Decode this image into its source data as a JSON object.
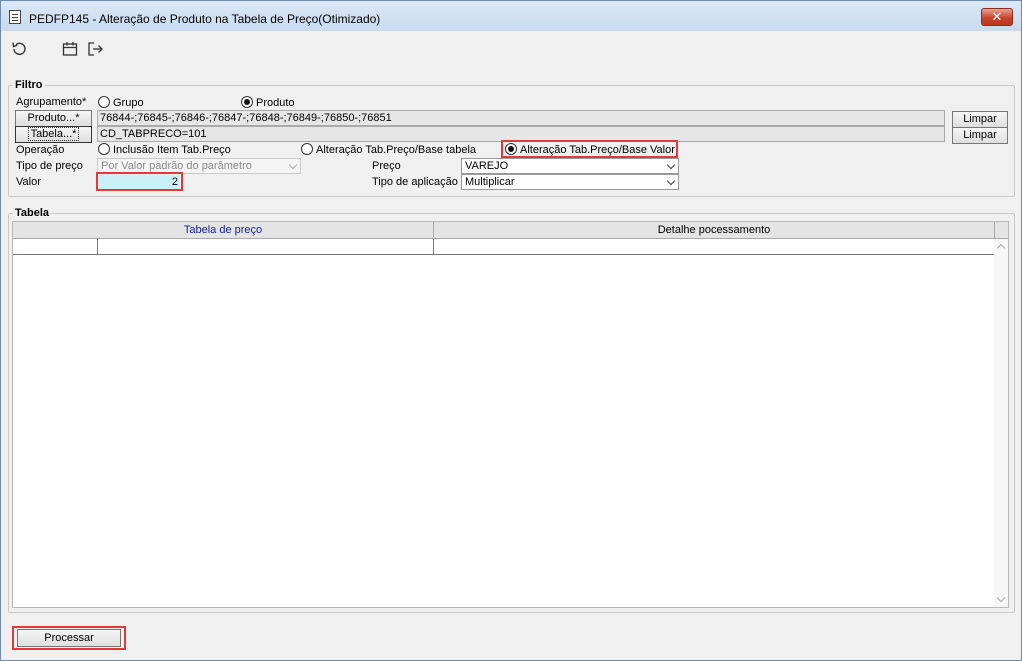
{
  "window": {
    "title": "PEDFP145 - Alteração de Produto na Tabela de Preço(Otimizado)",
    "close_symbol": "✕"
  },
  "toolbar": {
    "icons": [
      "refresh-icon",
      "calendar-icon",
      "exit-icon"
    ]
  },
  "filtro": {
    "legend": "Filtro",
    "agrupamento_label": "Agrupamento*",
    "agrupamento_options": [
      {
        "label": "Grupo",
        "checked": false
      },
      {
        "label": "Produto",
        "checked": true
      }
    ],
    "produto_button": "Produto...*",
    "produto_value": "76844-;76845-;76846-;76847-;76848-;76849-;76850-;76851",
    "tabela_button": "Tabela...*",
    "tabela_value": "CD_TABPRECO=101",
    "limpar_label": "Limpar",
    "operacao_label": "Operação",
    "operacao_options": [
      {
        "label": "Inclusão Item Tab.Preço",
        "checked": false
      },
      {
        "label": "Alteração Tab.Preço/Base tabela",
        "checked": false
      },
      {
        "label": "Alteração Tab.Preço/Base Valor",
        "checked": true
      }
    ],
    "tipo_preco_label": "Tipo de preço",
    "tipo_preco_value": "Por Valor padrão do parâmetro",
    "preco_label": "Preço",
    "preco_value": "VAREJO",
    "valor_label": "Valor",
    "valor_value": "2",
    "tipo_aplicacao_label": "Tipo de aplicação",
    "tipo_aplicacao_value": "Multiplicar"
  },
  "tabela": {
    "legend": "Tabela",
    "columns": [
      "Tabela de preço",
      "Detalhe pocessamento"
    ]
  },
  "footer": {
    "processar_label": "Processar"
  },
  "colors": {
    "highlight": "#e23a3a",
    "valor_bg": "#c9f1f7",
    "column_link": "#1c1c9c"
  }
}
